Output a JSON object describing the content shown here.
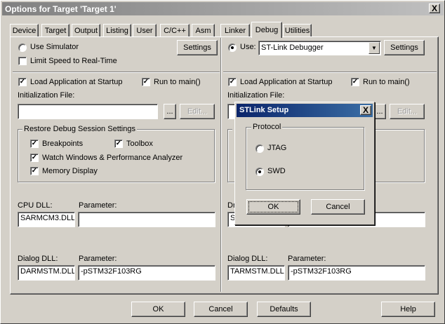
{
  "window": {
    "title": "Options for Target 'Target 1'",
    "close_glyph": "X"
  },
  "tabs": [
    "Device",
    "Target",
    "Output",
    "Listing",
    "User",
    "C/C++",
    "Asm",
    "Linker",
    "Debug",
    "Utilities"
  ],
  "active_tab": "Debug",
  "left": {
    "use_simulator": "Use Simulator",
    "limit_speed": "Limit Speed to Real-Time",
    "settings": "Settings",
    "load_app": "Load Application at Startup",
    "run_to_main": "Run to main()",
    "init_file_label": "Initialization File:",
    "browse": "...",
    "edit": "Edit...",
    "restore_group": "Restore Debug Session Settings",
    "breakpoints": "Breakpoints",
    "toolbox": "Toolbox",
    "watch_windows": "Watch Windows & Performance Analyzer",
    "memory_display": "Memory Display",
    "cpu_dll_label": "CPU DLL:",
    "cpu_param_label": "Parameter:",
    "cpu_dll_value": "SARMCM3.DLL",
    "cpu_param_value": "",
    "dialog_dll_label": "Dialog DLL:",
    "dialog_param_label": "Parameter:",
    "dialog_dll_value": "DARMSTM.DLL",
    "dialog_param_value": "-pSTM32F103RG"
  },
  "right": {
    "use": "Use:",
    "debugger": "ST-Link Debugger",
    "settings": "Settings",
    "load_app": "Load Application at Startup",
    "run_to_main": "Run to main()",
    "init_file_label": "Initialization File:",
    "browse": "...",
    "edit": "Edit...",
    "restore_partial": "I",
    "driver_partial": "Dr",
    "driver_value_partial": "S",
    "dialog_dll_label": "Dialog DLL:",
    "dialog_param_label": "Parameter:",
    "dialog_dll_value": "TARMSTM.DLL",
    "dialog_param_value": "-pSTM32F103RG"
  },
  "stlink_dialog": {
    "title": "STLink Setup",
    "close_glyph": "X",
    "protocol_group": "Protocol",
    "jtag": "JTAG",
    "swd": "SWD",
    "selected": "SWD",
    "ok": "OK",
    "cancel": "Cancel"
  },
  "footer": {
    "ok": "OK",
    "cancel": "Cancel",
    "defaults": "Defaults",
    "help": "Help"
  }
}
